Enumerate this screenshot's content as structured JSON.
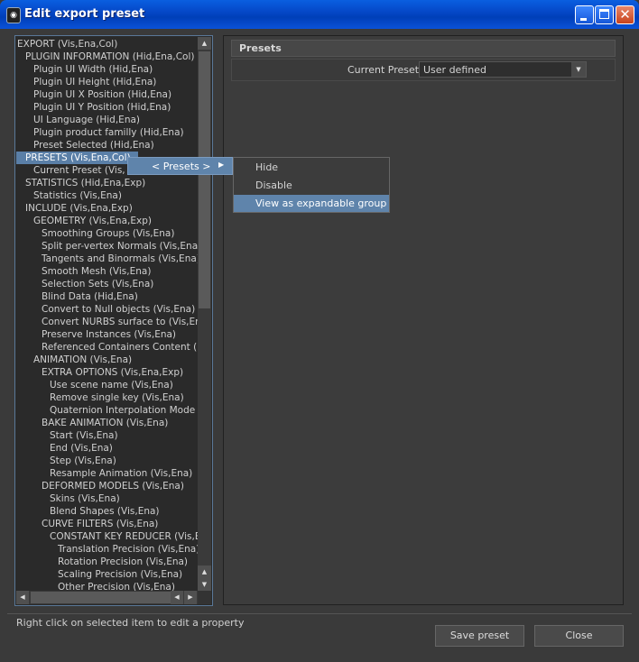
{
  "window": {
    "title": "Edit export preset",
    "close_glyph": "✕"
  },
  "tree": {
    "items": [
      {
        "label": "EXPORT (Vis,Ena,Col)",
        "indent": 0
      },
      {
        "label": "PLUGIN INFORMATION (Hid,Ena,Col)",
        "indent": 1
      },
      {
        "label": "Plugin UI Width (Hid,Ena)",
        "indent": 2
      },
      {
        "label": "Plugin UI Height (Hid,Ena)",
        "indent": 2
      },
      {
        "label": "Plugin UI X Position (Hid,Ena)",
        "indent": 2
      },
      {
        "label": "Plugin UI Y Position (Hid,Ena)",
        "indent": 2
      },
      {
        "label": "UI Language (Hid,Ena)",
        "indent": 2
      },
      {
        "label": "Plugin product familly (Hid,Ena)",
        "indent": 2
      },
      {
        "label": "Preset Selected (Hid,Ena)",
        "indent": 2
      },
      {
        "label": "PRESETS (Vis,Ena,Col)",
        "indent": 1,
        "selected": true
      },
      {
        "label": "Current Preset (Vis,",
        "indent": 2
      },
      {
        "label": "STATISTICS (Hid,Ena,Exp)",
        "indent": 1
      },
      {
        "label": "Statistics (Vis,Ena)",
        "indent": 2
      },
      {
        "label": "INCLUDE (Vis,Ena,Exp)",
        "indent": 1
      },
      {
        "label": "GEOMETRY (Vis,Ena,Exp)",
        "indent": 2
      },
      {
        "label": "Smoothing Groups (Vis,Ena)",
        "indent": 3
      },
      {
        "label": "Split per-vertex Normals (Vis,Ena)",
        "indent": 3
      },
      {
        "label": "Tangents and Binormals (Vis,Ena)",
        "indent": 3
      },
      {
        "label": "Smooth Mesh (Vis,Ena)",
        "indent": 3
      },
      {
        "label": "Selection Sets (Vis,Ena)",
        "indent": 3
      },
      {
        "label": "Blind Data (Hid,Ena)",
        "indent": 3
      },
      {
        "label": "Convert to Null objects (Vis,Ena)",
        "indent": 3
      },
      {
        "label": "Convert NURBS surface to (Vis,En",
        "indent": 3
      },
      {
        "label": "Preserve Instances (Vis,Ena)",
        "indent": 3
      },
      {
        "label": "Referenced Containers Content (",
        "indent": 3
      },
      {
        "label": "ANIMATION (Vis,Ena)",
        "indent": 2
      },
      {
        "label": "EXTRA OPTIONS (Vis,Ena,Exp)",
        "indent": 3
      },
      {
        "label": "Use scene name (Vis,Ena)",
        "indent": 4
      },
      {
        "label": "Remove single key (Vis,Ena)",
        "indent": 4
      },
      {
        "label": "Quaternion Interpolation Mode (",
        "indent": 4
      },
      {
        "label": "BAKE ANIMATION (Vis,Ena)",
        "indent": 3
      },
      {
        "label": "Start (Vis,Ena)",
        "indent": 4
      },
      {
        "label": "End (Vis,Ena)",
        "indent": 4
      },
      {
        "label": "Step (Vis,Ena)",
        "indent": 4
      },
      {
        "label": "Resample Animation (Vis,Ena)",
        "indent": 4
      },
      {
        "label": "DEFORMED MODELS (Vis,Ena)",
        "indent": 3
      },
      {
        "label": "Skins (Vis,Ena)",
        "indent": 4
      },
      {
        "label": "Blend Shapes (Vis,Ena)",
        "indent": 4
      },
      {
        "label": "CURVE FILTERS (Vis,Ena)",
        "indent": 3
      },
      {
        "label": "CONSTANT KEY REDUCER (Vis,Ena",
        "indent": 4
      },
      {
        "label": "Translation Precision (Vis,Ena)",
        "indent": 5
      },
      {
        "label": "Rotation Precision (Vis,Ena)",
        "indent": 5
      },
      {
        "label": "Scaling Precision (Vis,Ena)",
        "indent": 5
      },
      {
        "label": "Other Precision (Vis,Ena)",
        "indent": 5
      }
    ]
  },
  "scroll": {
    "up": "▲",
    "down": "▼",
    "left": "◀",
    "right": "▶"
  },
  "presets_panel": {
    "title": "Presets",
    "current_preset_label": "Current Preset:",
    "current_preset_value": "User defined",
    "dropdown_glyph": "▼"
  },
  "context_menu": {
    "presets_label": "< Presets >",
    "arrow": "▶",
    "submenu": [
      "Hide",
      "Disable",
      "View as expandable group"
    ],
    "highlighted_index": 2
  },
  "footer": {
    "hint": "Right click on selected item to edit a property",
    "save_button": "Save preset",
    "close_button": "Close"
  }
}
